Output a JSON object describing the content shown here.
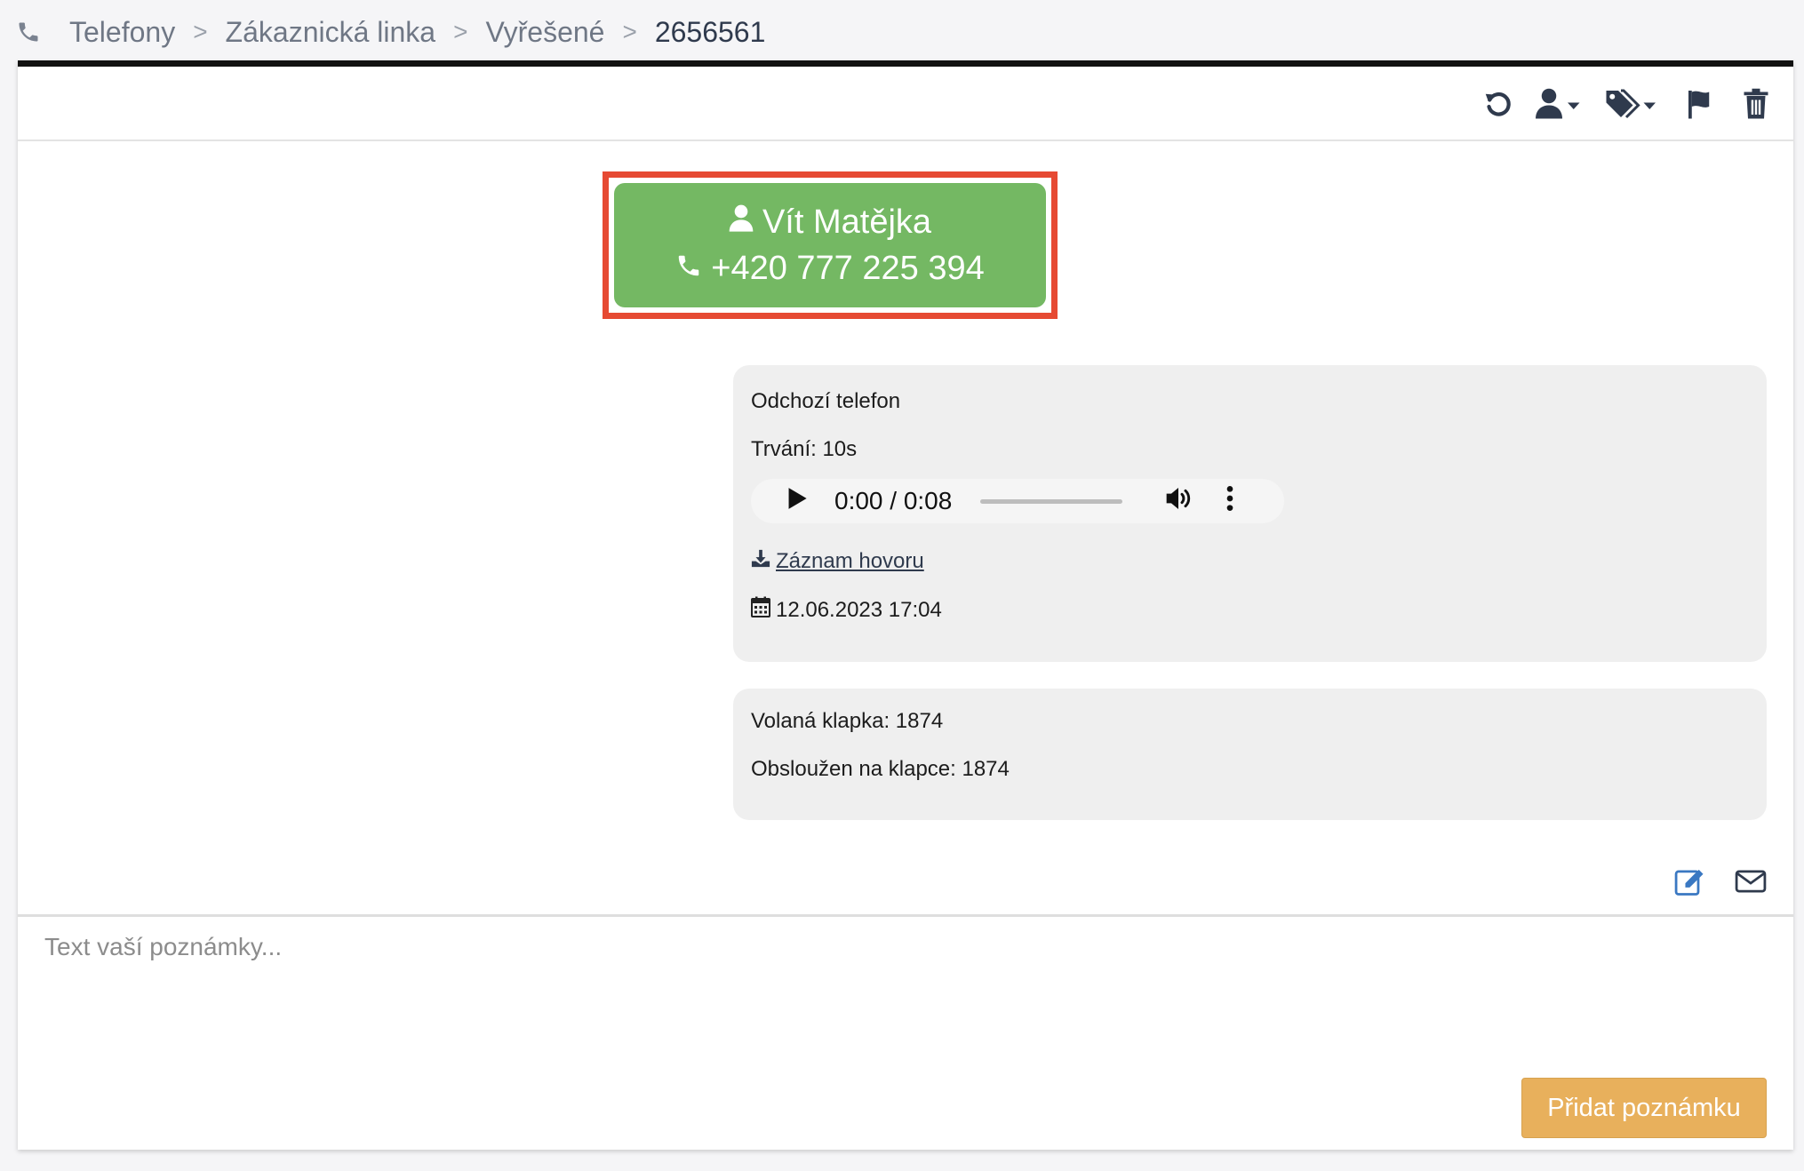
{
  "breadcrumb": {
    "icon": "phone-icon",
    "items": [
      "Telefony",
      "Zákaznická linka",
      "Vyřešené",
      "2656561"
    ],
    "separator": ">"
  },
  "toolbar": {
    "icons": [
      "refresh-icon",
      "assign-user-icon",
      "tags-icon",
      "flag-icon",
      "trash-icon"
    ]
  },
  "contact": {
    "name": "Vít Matějka",
    "phone": "+420 777 225 394",
    "color": "#74b863",
    "highlight_color": "#e64a33"
  },
  "call_card": {
    "type": "Odchozí telefon",
    "duration": "Trvání: 10s",
    "audio_time": "0:00 / 0:08",
    "recording_link": "Záznam hovoru",
    "datetime": "12.06.2023 17:04"
  },
  "extension_card": {
    "called_extension": "Volaná klapka: 1874",
    "served_extension": "Obsloužen na klapce: 1874"
  },
  "note": {
    "placeholder": "Text vaší poznámky...",
    "submit_label": "Přidat poznámku",
    "submit_color": "#e8b05c"
  }
}
